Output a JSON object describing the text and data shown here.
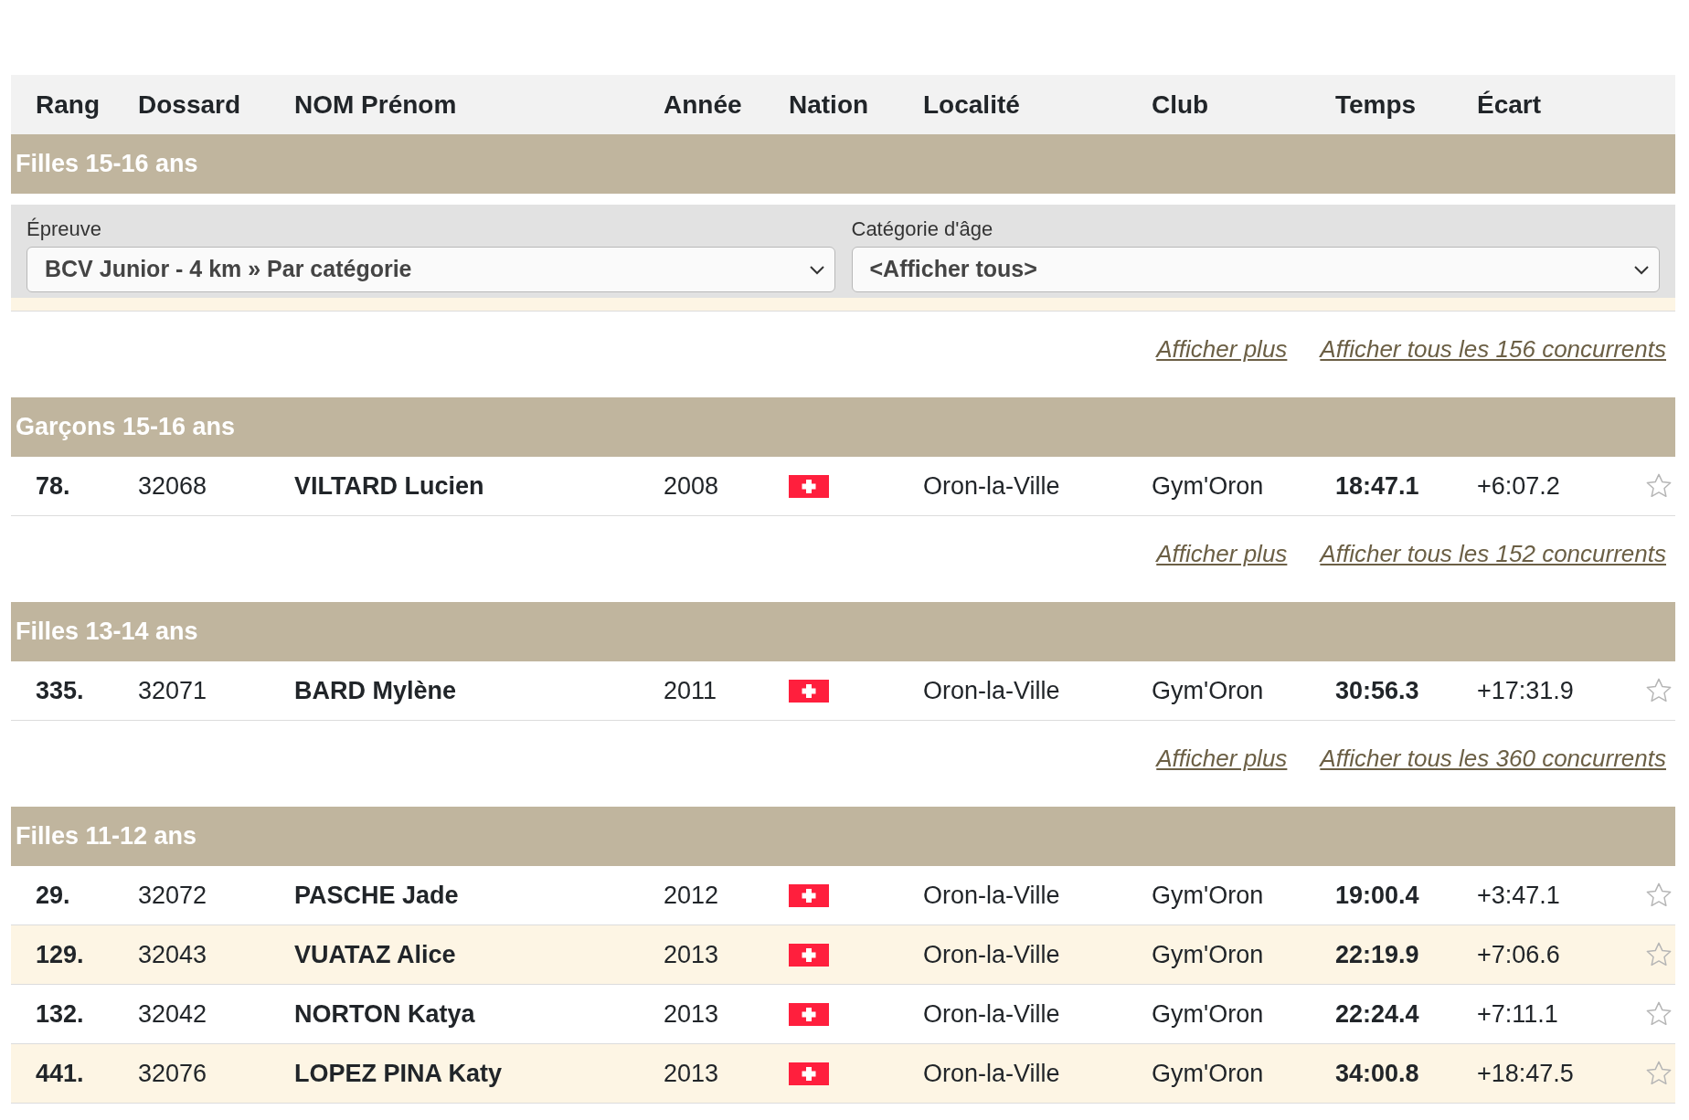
{
  "columns": [
    "Rang",
    "Dossard",
    "NOM Prénom",
    "Année",
    "Nation",
    "Localité",
    "Club",
    "Temps",
    "Écart"
  ],
  "groups": [
    {
      "title": "Filles 15-16 ans",
      "filters": [
        {
          "label": "Épreuve",
          "value": "BCV Junior - 4 km » Par catégorie"
        },
        {
          "label": "Catégorie d'âge",
          "value": "<Afficher tous>"
        }
      ],
      "links": [
        "Afficher plus",
        "Afficher tous les 156 concurrents"
      ]
    },
    {
      "title": "Garçons 15-16 ans",
      "rows": [
        {
          "rank": "78.",
          "bib": "32068",
          "name": "VILTARD Lucien",
          "year": "2008",
          "locality": "Oron-la-Ville",
          "club": "Gym'Oron",
          "time": "18:47.1",
          "gap": "+6:07.2",
          "starred": false
        }
      ],
      "links": [
        "Afficher plus",
        "Afficher tous les 152 concurrents"
      ]
    },
    {
      "title": "Filles 13-14 ans",
      "rows": [
        {
          "rank": "335.",
          "bib": "32071",
          "name": "BARD Mylène",
          "year": "2011",
          "locality": "Oron-la-Ville",
          "club": "Gym'Oron",
          "time": "30:56.3",
          "gap": "+17:31.9",
          "starred": false
        }
      ],
      "links": [
        "Afficher plus",
        "Afficher tous les 360 concurrents"
      ]
    },
    {
      "title": "Filles 11-12 ans",
      "rows": [
        {
          "rank": "29.",
          "bib": "32072",
          "name": "PASCHE Jade",
          "year": "2012",
          "locality": "Oron-la-Ville",
          "club": "Gym'Oron",
          "time": "19:00.4",
          "gap": "+3:47.1",
          "starred": false
        },
        {
          "rank": "129.",
          "bib": "32043",
          "name": "VUATAZ Alice",
          "year": "2013",
          "locality": "Oron-la-Ville",
          "club": "Gym'Oron",
          "time": "22:19.9",
          "gap": "+7:06.6",
          "starred": false
        },
        {
          "rank": "132.",
          "bib": "32042",
          "name": "NORTON Katya",
          "year": "2013",
          "locality": "Oron-la-Ville",
          "club": "Gym'Oron",
          "time": "22:24.4",
          "gap": "+7:11.1",
          "starred": false
        },
        {
          "rank": "441.",
          "bib": "32076",
          "name": "LOPEZ PINA Katy",
          "year": "2013",
          "locality": "Oron-la-Ville",
          "club": "Gym'Oron",
          "time": "34:00.8",
          "gap": "+18:47.5",
          "starred": false
        }
      ]
    }
  ]
}
